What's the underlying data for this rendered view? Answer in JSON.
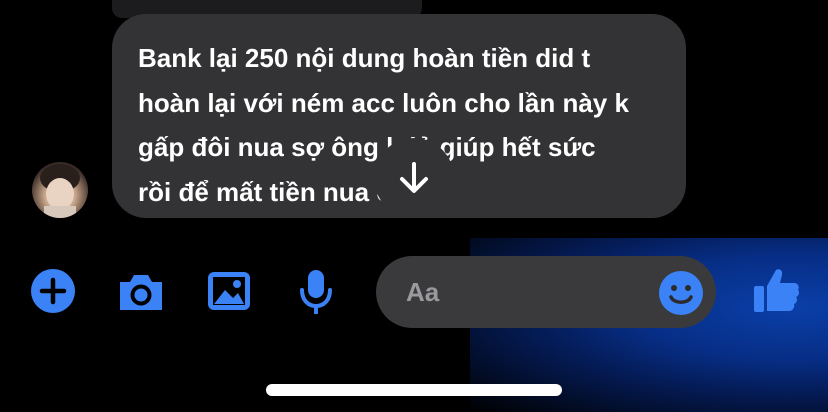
{
  "message": {
    "text": "Bank lại 250 nội dung hoàn tiền did t\nhoàn lại với ném acc luôn cho lần này k\ngấp đôi nua sợ ông l đủ giúp hết sức\nrồi để mất tiền nua ông"
  },
  "composer": {
    "placeholder": "Aa"
  },
  "icons": {
    "add": "plus-circle-icon",
    "camera": "camera-icon",
    "gallery": "image-icon",
    "voice": "microphone-icon",
    "emoji": "emoji-icon",
    "like": "thumbs-up-icon",
    "scroll": "arrow-down-icon"
  },
  "colors": {
    "accent": "#3b82f6",
    "bubble": "#333335",
    "background": "#000000"
  }
}
